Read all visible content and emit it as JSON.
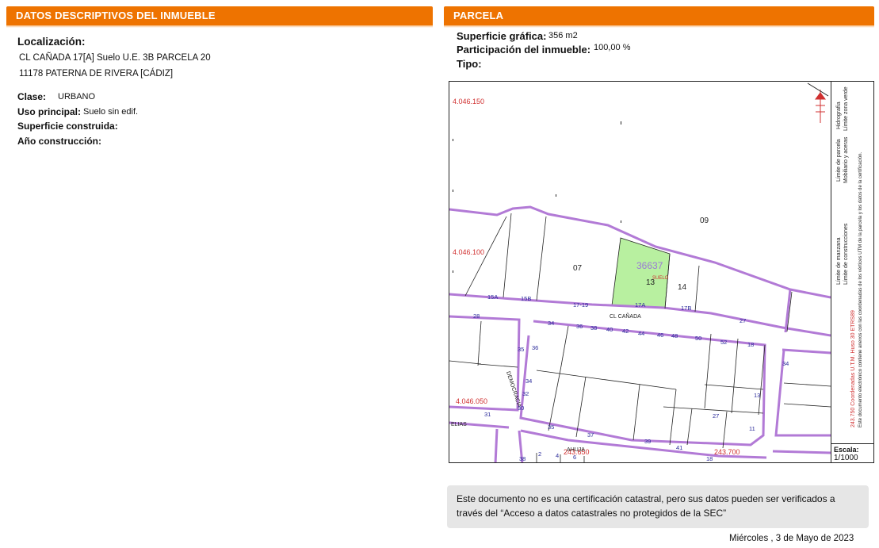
{
  "left_section": {
    "header": "DATOS DESCRIPTIVOS DEL INMUEBLE",
    "localizacion_label": "Localización:",
    "address_line1": "CL CAÑADA 17[A] Suelo U.E. 3B PARCELA 20",
    "address_line2": "11178 PATERNA DE RIVERA [CÁDIZ]",
    "clase_label": "Clase:",
    "clase_value": "URBANO",
    "uso_label": "Uso principal:",
    "uso_value": "Suelo sin edif.",
    "superficie_construida_label": "Superficie construida:",
    "anio_label": "Año construcción:"
  },
  "right_section": {
    "header": "PARCELA",
    "superficie_label": "Superficie gráfica:",
    "superficie_value": "356 m2",
    "participacion_label": "Participación del inmueble:",
    "participacion_value": "100,00 %",
    "tipo_label": "Tipo:"
  },
  "map": {
    "coord_y1": "4.046.150",
    "coord_y2": "4.046.100",
    "coord_y3": "4.046.050",
    "coord_x1": "243.650",
    "coord_x2": "243.700",
    "parcel_ref": "36637",
    "parcel_num": "13",
    "parcel_type": "SUELO",
    "block_07": "07",
    "block_09": "09",
    "block_14": "14",
    "street_canada": "CL CAÑADA",
    "street_democracia": "DEMOCRACIA",
    "street_ahuja": "AHUJA",
    "street_elias": "ELIAS",
    "numbers": {
      "n15a": "15A",
      "n15b": "15B",
      "n17_19": "17-19",
      "n17a": "17A",
      "n17b": "17B",
      "n27": "27",
      "n28": "28",
      "n34": "34",
      "n36": "36",
      "n38": "38",
      "n40": "40",
      "n42": "42",
      "n44": "44",
      "n46": "46",
      "n48": "48",
      "n50": "50",
      "n52": "52",
      "n18": "18",
      "n35": "35",
      "n33": "33",
      "n31": "31",
      "n30": "30",
      "n32": "32",
      "n34b": "34",
      "n36b": "36",
      "n37": "37",
      "n39": "39",
      "n41": "41",
      "n27b": "27",
      "n13": "13",
      "n11": "11",
      "n34c": "34",
      "n2": "2",
      "n4": "4",
      "n6": "6",
      "n18b": "18",
      "n38b": "38"
    },
    "legend_1": "Límite de manzana",
    "legend_2": "Límite de parcela",
    "legend_3": "Hidrografía",
    "legend_4": "Límite de construcciones",
    "legend_5": "Mobiliario y aceras",
    "legend_6": "Límite zona verde",
    "legend_7": "243.750 Coordenadas U.T.M. Huso 30 ETRS89",
    "legend_8": "Este documento electrónico contiene anexos con las coordenadas de los vértices UTM de la parcela y los datos de la certificación.",
    "scale_label": "Escala:",
    "scale_value": "1/1000"
  },
  "note": "Este documento no es una certificación catastral, pero sus datos pueden ser verificados a través del “Acceso a datos catastrales no protegidos de la SEC”",
  "date": "Miércoles , 3 de Mayo de 2023",
  "colors": {
    "header": "#ee7300",
    "block_line": "#b27ad6",
    "parcel_fill": "#b8f0a0",
    "coord_text": "#d03030",
    "number_text": "#2a2a9a"
  }
}
